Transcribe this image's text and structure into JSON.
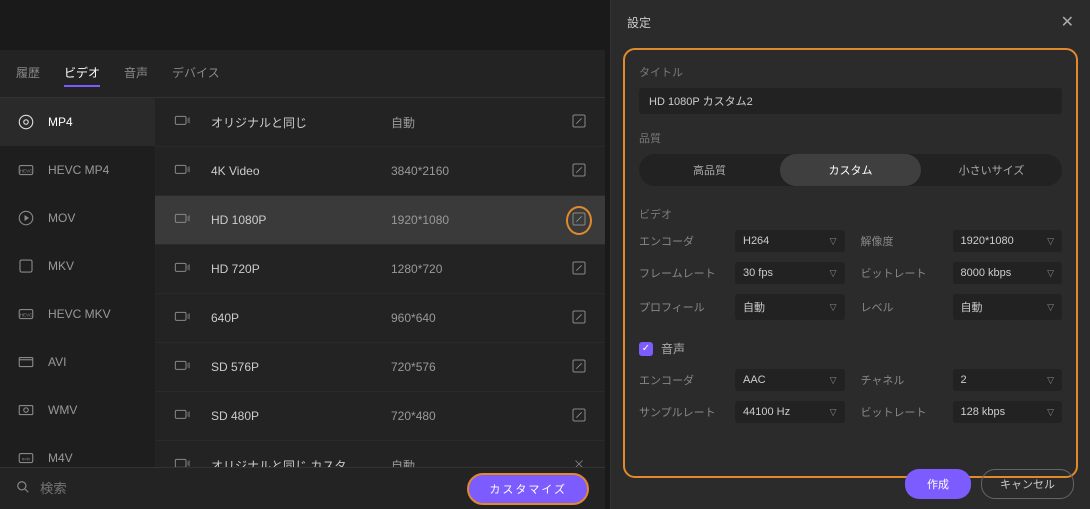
{
  "tabs": {
    "history": "履歴",
    "video": "ビデオ",
    "audio": "音声",
    "device": "デバイス"
  },
  "formats": [
    "MP4",
    "HEVC MP4",
    "MOV",
    "MKV",
    "HEVC MKV",
    "AVI",
    "WMV",
    "M4V"
  ],
  "presets": [
    {
      "name": "オリジナルと同じ",
      "res": "自動",
      "edit": true
    },
    {
      "name": "4K Video",
      "res": "3840*2160",
      "edit": true
    },
    {
      "name": "HD 1080P",
      "res": "1920*1080",
      "edit": true,
      "selected": true,
      "highlight": true
    },
    {
      "name": "HD 720P",
      "res": "1280*720",
      "edit": true
    },
    {
      "name": "640P",
      "res": "960*640",
      "edit": true
    },
    {
      "name": "SD 576P",
      "res": "720*576",
      "edit": true
    },
    {
      "name": "SD 480P",
      "res": "720*480",
      "edit": true
    },
    {
      "name": "オリジナルと同じ カスタ...",
      "res": "自動",
      "edit": false
    }
  ],
  "search": {
    "placeholder": "検索"
  },
  "customize_btn": "カスタマイズ",
  "dialog": {
    "title": "設定",
    "section_title": "タイトル",
    "title_value": "HD 1080P カスタム2",
    "quality_label": "品質",
    "quality_opts": {
      "high": "高品質",
      "custom": "カスタム",
      "small": "小さいサイズ"
    },
    "video_label": "ビデオ",
    "video": {
      "encoder_l": "エンコーダ",
      "encoder_v": "H264",
      "resolution_l": "解像度",
      "resolution_v": "1920*1080",
      "framerate_l": "フレームレート",
      "framerate_v": "30 fps",
      "bitrate_l": "ビットレート",
      "bitrate_v": "8000 kbps",
      "profile_l": "プロフィール",
      "profile_v": "自動",
      "level_l": "レベル",
      "level_v": "自動"
    },
    "audio_label": "音声",
    "audio": {
      "encoder_l": "エンコーダ",
      "encoder_v": "AAC",
      "channel_l": "チャネル",
      "channel_v": "2",
      "samplerate_l": "サンプルレート",
      "samplerate_v": "44100 Hz",
      "bitrate_l": "ビットレート",
      "bitrate_v": "128 kbps"
    },
    "create_btn": "作成",
    "cancel_btn": "キャンセル"
  }
}
